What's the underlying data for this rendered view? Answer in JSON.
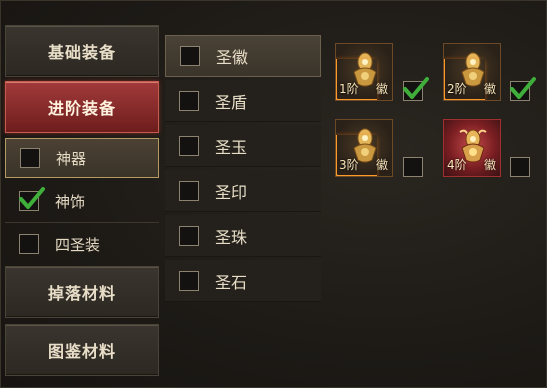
{
  "categories": [
    {
      "label": "基础装备",
      "active": false
    },
    {
      "label": "进阶装备",
      "active": true
    },
    {
      "label": "掉落材料",
      "active": false
    },
    {
      "label": "图鉴材料",
      "active": false
    }
  ],
  "subcategories": [
    {
      "label": "神器",
      "checked": false,
      "selected": true
    },
    {
      "label": "神饰",
      "checked": true,
      "selected": false
    },
    {
      "label": "四圣装",
      "checked": false,
      "selected": false
    }
  ],
  "list": [
    {
      "label": "圣徽",
      "checked": false,
      "selected": true
    },
    {
      "label": "圣盾",
      "checked": false,
      "selected": false
    },
    {
      "label": "圣玉",
      "checked": false,
      "selected": false
    },
    {
      "label": "圣印",
      "checked": false,
      "selected": false
    },
    {
      "label": "圣珠",
      "checked": false,
      "selected": false
    },
    {
      "label": "圣石",
      "checked": false,
      "selected": false
    }
  ],
  "items": [
    {
      "level": "1阶",
      "type": "徽",
      "checked": true,
      "style": "gold"
    },
    {
      "level": "2阶",
      "type": "徽",
      "checked": true,
      "style": "gold"
    },
    {
      "level": "3阶",
      "type": "徽",
      "checked": false,
      "style": "gold"
    },
    {
      "level": "4阶",
      "type": "徽",
      "checked": false,
      "style": "red"
    }
  ],
  "colors": {
    "check": "#3fae3a",
    "active_red": "#a23a3a",
    "glow": "#ff9a2a"
  }
}
